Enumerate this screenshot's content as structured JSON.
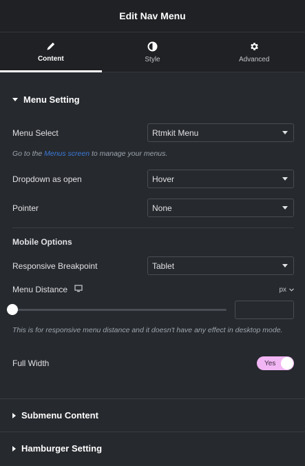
{
  "header": {
    "title": "Edit Nav Menu"
  },
  "tabs": [
    {
      "label": "Content",
      "icon": "pencil-icon",
      "active": true
    },
    {
      "label": "Style",
      "icon": "half-circle-icon",
      "active": false
    },
    {
      "label": "Advanced",
      "icon": "gear-icon",
      "active": false
    }
  ],
  "menu_setting": {
    "title": "Menu Setting",
    "menu_select": {
      "label": "Menu Select",
      "value": "Rtmkit Menu"
    },
    "help": {
      "prefix": "Go to the ",
      "link": "Menus screen",
      "suffix": " to manage your menus."
    },
    "dropdown": {
      "label": "Dropdown as open",
      "value": "Hover"
    },
    "pointer": {
      "label": "Pointer",
      "value": "None"
    },
    "mobile_options": "Mobile Options",
    "breakpoint": {
      "label": "Responsive Breakpoint",
      "value": "Tablet"
    },
    "menu_distance": {
      "label": "Menu Distance",
      "unit": "px",
      "value": 0,
      "help": "This is for responsive menu distance and it doesn't have any effect in desktop mode."
    },
    "full_width": {
      "label": "Full Width",
      "toggle": "Yes"
    }
  },
  "submenu": {
    "title": "Submenu Content"
  },
  "hamburger": {
    "title": "Hamburger Setting"
  },
  "colors": {
    "accent_link": "#3b7bd9",
    "toggle_on": "#f3b6f5",
    "panel_bg": "#26292e"
  }
}
